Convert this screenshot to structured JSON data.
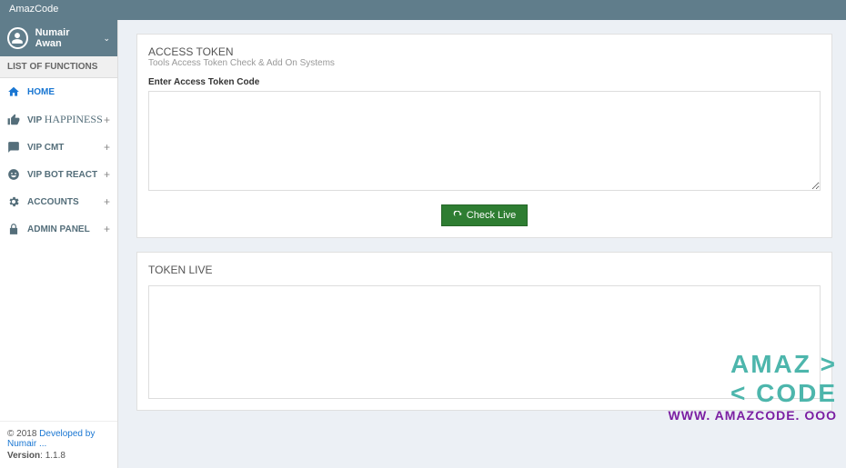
{
  "header": {
    "brand": "AmazCode"
  },
  "user": {
    "name": "Numair Awan"
  },
  "sidebar": {
    "header": "LIST OF FUNCTIONS",
    "items": [
      {
        "label": "HOME",
        "icon": "home",
        "active": true,
        "expandable": false
      },
      {
        "label": "VIP ",
        "label_serif": "HAPPINESS",
        "icon": "thumbs-up",
        "expandable": true
      },
      {
        "label": "VIP CMT",
        "icon": "comment",
        "expandable": true
      },
      {
        "label": "VIP BOT REACT",
        "icon": "smile",
        "expandable": true
      },
      {
        "label": "ACCOUNTS",
        "icon": "gear",
        "expandable": true
      },
      {
        "label": "ADMIN PANEL",
        "icon": "admin",
        "expandable": true
      }
    ]
  },
  "footer": {
    "copyright_prefix": "© 2018 ",
    "copyright_link": "Developed by Numair ...",
    "version_label": "Version",
    "version": "1.1.8"
  },
  "panel_token": {
    "title": "ACCESS TOKEN",
    "subtitle": "Tools Access Token Check & Add On Systems",
    "input_label": "Enter Access Token Code",
    "button": "Check Live"
  },
  "panel_live": {
    "title": "TOKEN LIVE"
  },
  "watermark": {
    "line1": "AMAZ >",
    "line2": "< CODE",
    "url": "WWW. AMAZCODE. OOO"
  }
}
